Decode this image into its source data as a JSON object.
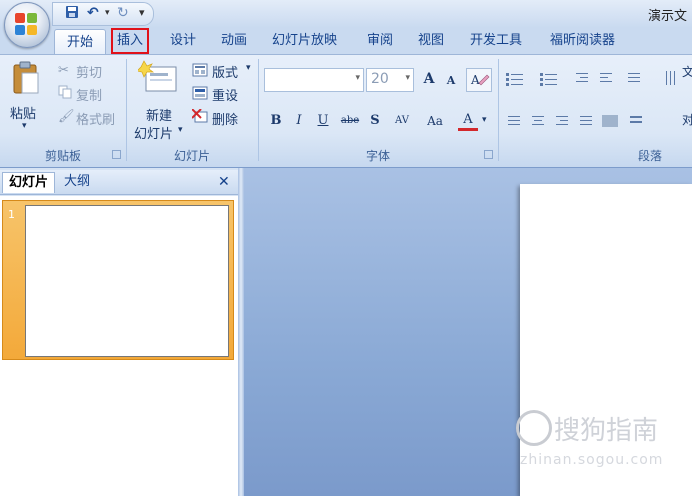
{
  "window": {
    "title": "演示文"
  },
  "quick_access": [
    {
      "name": "save-icon",
      "glyph": "💾"
    },
    {
      "name": "undo-icon",
      "glyph": "↶"
    },
    {
      "name": "redo-icon",
      "glyph": "↻"
    },
    {
      "name": "customize-qat-icon",
      "glyph": "▾"
    }
  ],
  "tabs": {
    "home": "开始",
    "insert": "插入",
    "design": "设计",
    "animation": "动画",
    "slideshow": "幻灯片放映",
    "review": "审阅",
    "view": "视图",
    "developer": "开发工具",
    "reader": "福昕阅读器"
  },
  "clipboard": {
    "paste": "粘贴",
    "paste_arrow": "▾",
    "cut": "剪切",
    "copy": "复制",
    "format_painter": "格式刷",
    "label": "剪贴板"
  },
  "slides_group": {
    "new_line1": "新建",
    "new_line2": "幻灯片",
    "new_arrow": "▾",
    "layout": "版式",
    "layout_arrow": "▾",
    "reset": "重设",
    "delete": "删除",
    "label": "幻灯片"
  },
  "font_group": {
    "font_name": "",
    "font_size": "20",
    "grow": "A",
    "shrink": "A",
    "bold": "B",
    "italic": "I",
    "underline": "U",
    "strike": "abe",
    "shadow": "S",
    "spacing": "AV",
    "case": "Aa",
    "color": "A",
    "label": "字体"
  },
  "paragraph_group": {
    "label": "段落",
    "text_dir_partial": "文",
    "align_partial": "对"
  },
  "pane": {
    "tab_slides": "幻灯片",
    "tab_outline": "大纲",
    "close": "✕",
    "slide_number": "1"
  },
  "watermark": {
    "text": "搜狗指南",
    "url": "zhinan.sogou.com"
  },
  "colors": {
    "accent": "#15428b",
    "highlight_border": "#e0121a",
    "thumb_frame": "#f3a93a"
  }
}
